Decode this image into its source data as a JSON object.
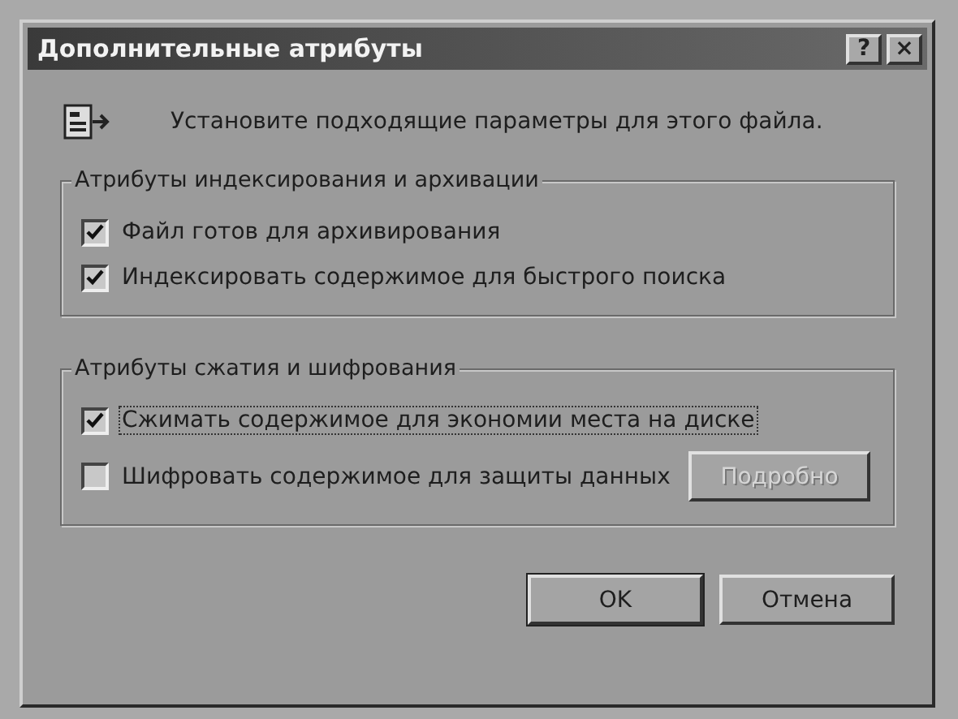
{
  "window": {
    "title": "Дополнительные атрибуты",
    "title_buttons": [
      "?",
      "×"
    ]
  },
  "intro": "Установите подходящие параметры для этого файла.",
  "groups": [
    {
      "title": "Атрибуты индексирования и архивации",
      "options": [
        {
          "label": "Файл готов для архивирования",
          "checked": true,
          "focused": false
        },
        {
          "label": "Индексировать содержимое для быстрого поиска",
          "checked": true,
          "focused": false
        }
      ]
    },
    {
      "title": "Атрибуты сжатия и шифрования",
      "options": [
        {
          "label": "Сжимать содержимое для экономии места на диске",
          "checked": true,
          "focused": true
        },
        {
          "label": "Шифровать содержимое для защиты данных",
          "checked": false,
          "focused": false
        }
      ],
      "side_button": {
        "label": "Подробно",
        "disabled": true
      }
    }
  ],
  "buttons": [
    {
      "label": "OK",
      "default": true
    },
    {
      "label": "Отмена",
      "default": false
    }
  ]
}
